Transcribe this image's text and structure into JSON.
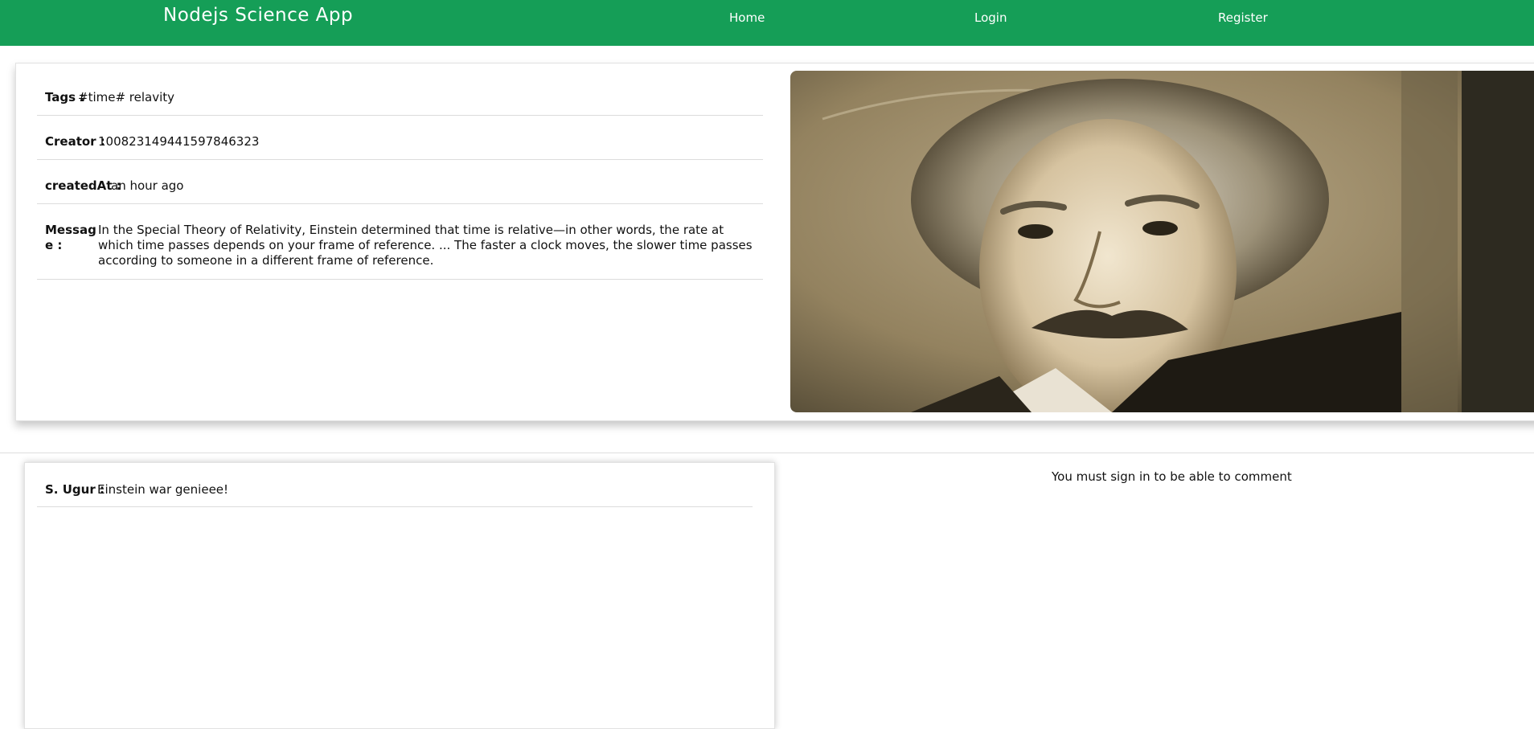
{
  "header": {
    "brand": "Nodejs Science App",
    "nav": [
      {
        "label": "Home"
      },
      {
        "label": "Login"
      },
      {
        "label": "Register"
      }
    ],
    "background_color": "#159e57"
  },
  "post": {
    "tags": {
      "label": "Tags :",
      "value": "#time# relavity"
    },
    "creator": {
      "label": "Creator :",
      "value": "100823149441597846323"
    },
    "created_at": {
      "label": "createdAt :",
      "value": "an hour ago"
    },
    "message": {
      "label": "Message :",
      "value": "In the Special Theory of Relativity, Einstein determined that time is relative—in other words, the rate at which time passes depends on your frame of reference. ... The faster a clock moves, the slower time passes according to someone in a different frame of reference."
    },
    "image": "sepia portrait photo"
  },
  "comments": [
    {
      "author": "S. Ugur :",
      "text": "Einstein war genieee!"
    }
  ],
  "signin_note": "You must sign in to be able to comment"
}
